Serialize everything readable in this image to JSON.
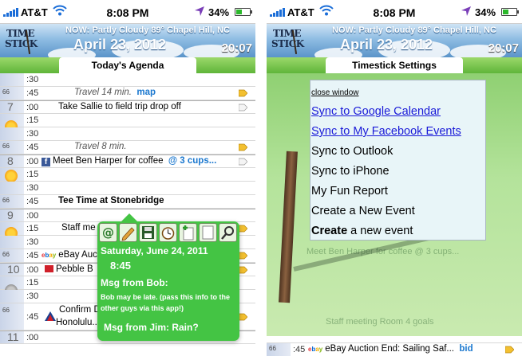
{
  "status": {
    "carrier": "AT&T",
    "time": "8:08 PM",
    "battery": "34%"
  },
  "header": {
    "logo_line1": "TIME",
    "logo_line2": "STICK",
    "weather": "NOW: Partly Cloudy  89° Chapel Hill, NC",
    "date": "April 23, 2012",
    "clock": "20:07"
  },
  "left": {
    "title": "Today's Agenda",
    "rows": [
      {
        "hour": "",
        "mins": ":30",
        "text": ""
      },
      {
        "hour": "",
        "temp": "66",
        "mins": ":45",
        "text": "Travel 14 min.",
        "link": "map"
      },
      {
        "hour": "7",
        "mins": ":00",
        "text": "Take Sallie to field trip drop off"
      },
      {
        "hour": "",
        "mins": ":15",
        "text": ""
      },
      {
        "hour": "",
        "mins": ":30",
        "text": ""
      },
      {
        "hour": "",
        "temp": "66",
        "mins": ":45",
        "text": "Travel 8 min."
      },
      {
        "hour": "8",
        "mins": ":00",
        "text": "Meet Ben Harper for coffee",
        "link": "@ 3 cups..."
      },
      {
        "hour": "",
        "mins": ":15",
        "text": ""
      },
      {
        "hour": "",
        "mins": ":30",
        "text": ""
      },
      {
        "hour": "",
        "temp": "66",
        "mins": ":45",
        "text": "Tee Time at Stonebridge"
      },
      {
        "hour": "9",
        "mins": ":00",
        "text": ""
      },
      {
        "hour": "",
        "mins": ":15",
        "text": "Staff me"
      },
      {
        "hour": "",
        "mins": ":30",
        "text": ""
      },
      {
        "hour": "",
        "temp": "66",
        "mins": ":45",
        "text": "eBay Auc"
      },
      {
        "hour": "10",
        "mins": ":00",
        "text": "Pebble B"
      },
      {
        "hour": "",
        "mins": ":15",
        "text": ""
      },
      {
        "hour": "",
        "mins": ":30",
        "text": ""
      },
      {
        "hour": "",
        "temp": "66",
        "mins": ":45",
        "text": "Confirm D",
        "text2": "Honolulu..."
      },
      {
        "hour": "11",
        "mins": ":00",
        "text": ""
      }
    ],
    "popup": {
      "date": "Saturday, June 24, 2011",
      "time": "8:45",
      "msg1": "Msg from Bob:",
      "note": "Bob may be late. (pass this info to the other guys via this app!)",
      "msg2": "Msg from Jim:  Rain?"
    }
  },
  "right": {
    "title": "Timestick Settings",
    "menu": {
      "close": "close window",
      "items": [
        "Sync to Google Calendar",
        "Sync to My Facebook Events",
        "Sync to Outlook",
        "Sync to iPhone",
        "My Fun Report",
        "Create a New Event"
      ],
      "last_bold": "Create",
      "last_rest": " a new event"
    },
    "bg_rows": {
      "r1": "Meet Ben Harper for coffee   @ 3 cups...",
      "r2": "Staff meeting Room 4  goals"
    },
    "bottom": {
      "temp": "66",
      "mins": ":45",
      "text": "eBay Auction End: Sailing Saf...",
      "link": "bid"
    }
  },
  "colors": {
    "accent_green": "#44c444",
    "link_blue": "#1b78cf"
  }
}
